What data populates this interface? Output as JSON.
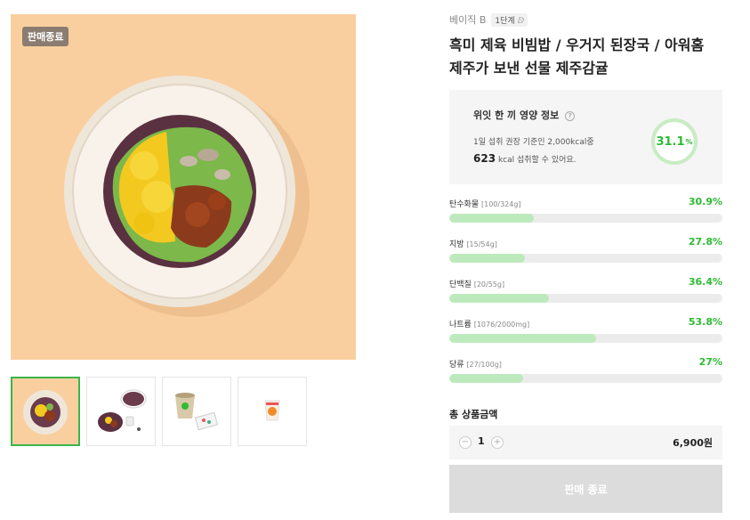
{
  "gallery": {
    "sold_badge": "판매종료",
    "main_bg_color": "#f9cf9f",
    "thumbnails": [
      {
        "name": "thumb-bowl-top",
        "active": true
      },
      {
        "name": "thumb-bowl-set",
        "active": false
      },
      {
        "name": "thumb-soup-cup",
        "active": false
      },
      {
        "name": "thumb-tangerine-pack",
        "active": false
      }
    ]
  },
  "product": {
    "brand": "베이직 B",
    "step_tag": "1단계",
    "title": "흑미 제육 비빔밥 / 우거지 된장국 / 아워홈 제주가 보낸 선물 제주감귤"
  },
  "nutrition": {
    "title": "위잇 한 끼 영양 정보",
    "subtitle": "1일 섭취 권장 기준인 2,000kcal중",
    "kcal_value": "623",
    "kcal_suffix": "kcal 섭취할 수 있어요.",
    "ring_percent": 31.1,
    "ring_value": "31.1",
    "ring_unit": "%",
    "accent_color": "#2dbb33",
    "items": [
      {
        "name": "탄수화물",
        "detail": "[100/324g]",
        "pct_label": "30.9%",
        "pct": 30.9
      },
      {
        "name": "지방",
        "detail": "[15/54g]",
        "pct_label": "27.8%",
        "pct": 27.8
      },
      {
        "name": "단백질",
        "detail": "[20/55g]",
        "pct_label": "36.4%",
        "pct": 36.4
      },
      {
        "name": "나트륨",
        "detail": "[1076/2000mg]",
        "pct_label": "53.8%",
        "pct": 53.8
      },
      {
        "name": "당류",
        "detail": "[27/100g]",
        "pct_label": "27%",
        "pct": 27
      }
    ]
  },
  "purchase": {
    "total_label": "총 상품금액",
    "minus": "−",
    "plus": "+",
    "quantity": "1",
    "price": "6,900원",
    "button_label": "판매 종료"
  }
}
